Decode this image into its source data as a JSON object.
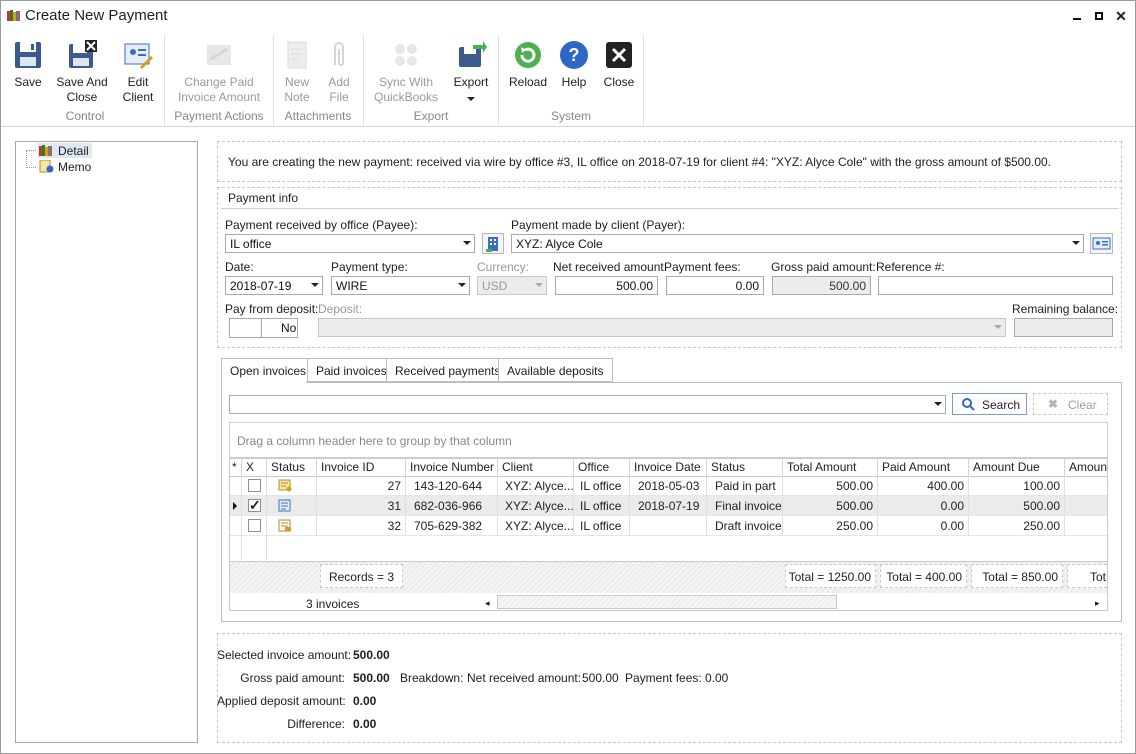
{
  "window": {
    "title": "Create New Payment"
  },
  "ribbon": {
    "save": "Save",
    "save_and_close": [
      "Save And",
      "Close"
    ],
    "edit_client": [
      "Edit",
      "Client"
    ],
    "group_control": "Control",
    "change_paid": [
      "Change Paid",
      "Invoice Amount"
    ],
    "group_payment_actions": "Payment Actions",
    "new_note": [
      "New",
      "Note"
    ],
    "add_file": [
      "Add",
      "File"
    ],
    "group_attachments": "Attachments",
    "sync_qb": [
      "Sync With",
      "QuickBooks"
    ],
    "export": "Export",
    "group_export": "Export",
    "reload": "Reload",
    "help": "Help",
    "close": "Close",
    "group_system": "System"
  },
  "tree": {
    "items": [
      "Detail",
      "Memo"
    ]
  },
  "info_message": "You are creating the new payment: received via wire by office #3, IL office on 2018-07-19 for client #4: \"XYZ: Alyce Cole\" with the gross amount of $500.00.",
  "payment_info": {
    "section_title": "Payment info",
    "payee_label": "Payment received by office (Payee):",
    "payee_value": "IL office",
    "payer_label": "Payment made by client (Payer):",
    "payer_value": "XYZ: Alyce Cole",
    "date_label": "Date:",
    "date_value": "2018-07-19",
    "type_label": "Payment type:",
    "type_value": "WIRE",
    "currency_label": "Currency:",
    "currency_value": "USD",
    "net_label": "Net received amount:",
    "net_value": "500.00",
    "fees_label": "Payment fees:",
    "fees_value": "0.00",
    "gross_label": "Gross paid amount:",
    "gross_value": "500.00",
    "reference_label": "Reference #:",
    "reference_value": "",
    "pay_from_deposit_label": "Pay from deposit:",
    "pay_from_deposit_value": "No",
    "deposit_label": "Deposit:",
    "remaining_label": "Remaining balance:"
  },
  "tabs": [
    "Open invoices",
    "Paid invoices",
    "Received payments",
    "Available deposits"
  ],
  "search": {
    "button": "Search",
    "clear": "Clear"
  },
  "grid": {
    "group_hint": "Drag a column header here to group by that column",
    "columns": [
      "*",
      "X",
      "Status",
      "Invoice ID",
      "Invoice Number",
      "Client",
      "Office",
      "Invoice Date",
      "Status",
      "Total Amount",
      "Paid Amount",
      "Amount Due",
      "Amount"
    ],
    "rows": [
      {
        "checked": false,
        "current": false,
        "status_icon": "partial-invoice-icon",
        "id": "27",
        "number": "143-120-644",
        "client": "XYZ: Alyce...",
        "office": "IL office",
        "date": "2018-05-03",
        "status": "Paid in part",
        "total": "500.00",
        "paid": "400.00",
        "due": "100.00"
      },
      {
        "checked": true,
        "current": true,
        "status_icon": "final-invoice-icon",
        "id": "31",
        "number": "682-036-966",
        "client": "XYZ: Alyce...",
        "office": "IL office",
        "date": "2018-07-19",
        "status": "Final invoice",
        "total": "500.00",
        "paid": "0.00",
        "due": "500.00"
      },
      {
        "checked": false,
        "current": false,
        "status_icon": "draft-invoice-icon",
        "id": "32",
        "number": "705-629-382",
        "client": "XYZ: Alyce...",
        "office": "IL office",
        "date": "",
        "status": "Draft invoice",
        "total": "250.00",
        "paid": "0.00",
        "due": "250.00"
      }
    ],
    "footer": {
      "records": "Records = 3",
      "total_amount": "Total = 1250.00",
      "total_paid": "Total = 400.00",
      "total_due": "Total = 850.00",
      "total_more": "Tot"
    },
    "pager": "3 invoices"
  },
  "summary": {
    "selected_label": "Selected invoice amount:",
    "selected_value": "500.00",
    "gross_label": "Gross paid amount:",
    "gross_value": "500.00",
    "breakdown_label": "Breakdown:",
    "net_label": "Net received amount:",
    "net_value": "500.00",
    "fees_label": "Payment fees:",
    "fees_value": "0.00",
    "applied_label": "Applied deposit amount:",
    "applied_value": "0.00",
    "difference_label": "Difference:",
    "difference_value": "0.00"
  },
  "colors": {
    "accent": "#3b6fc4",
    "selection": "#dfe7f3",
    "disabled": "#9a9a9a"
  }
}
